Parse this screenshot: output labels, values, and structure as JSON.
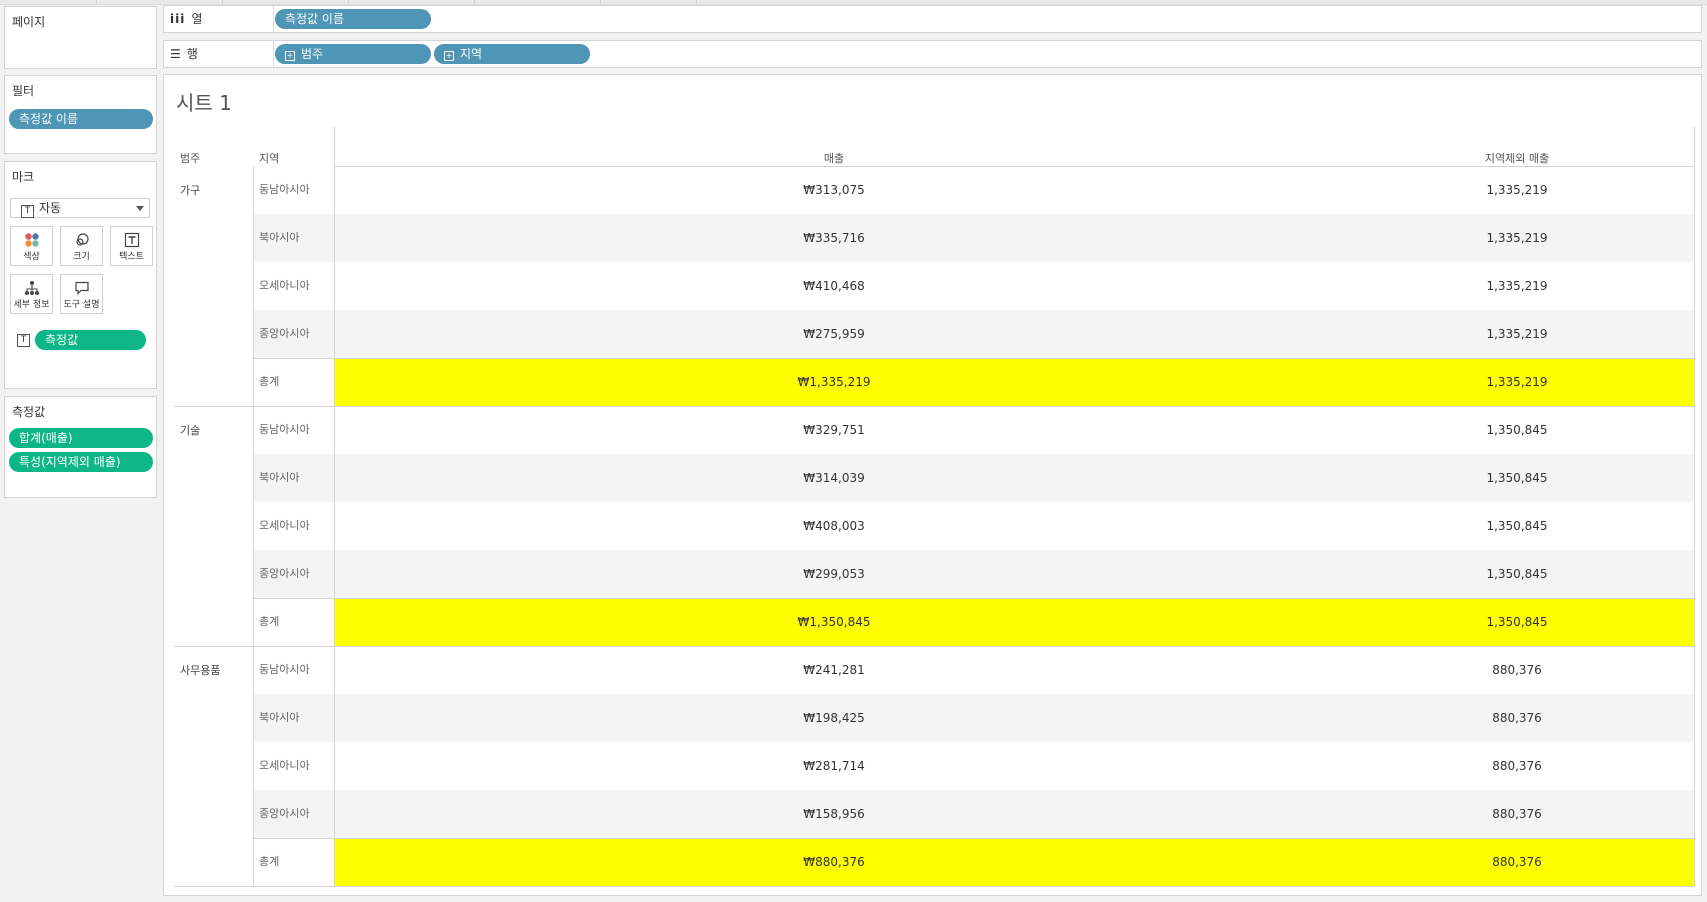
{
  "left_panel": {
    "pages_title": "페이지",
    "filters_title": "필터",
    "filter_pill": "측정값 이름",
    "marks_title": "마크",
    "mark_type": "자동",
    "mark_buttons": [
      {
        "label": "색상",
        "icon": "color-icon"
      },
      {
        "label": "크기",
        "icon": "size-icon"
      },
      {
        "label": "텍스트",
        "icon": "text-icon"
      },
      {
        "label": "세부 정보",
        "icon": "detail-icon"
      },
      {
        "label": "도구 설명",
        "icon": "tooltip-icon"
      }
    ],
    "mark_text_pill": "측정값",
    "measures_title": "측정값",
    "measure_pills": [
      "합계(매출)",
      "특성(지역제외 매출)"
    ]
  },
  "shelves": {
    "columns_label": "열",
    "columns_pill": "측정값 이름",
    "rows_label": "행",
    "rows_pills": [
      "범주",
      "지역"
    ]
  },
  "sheet": {
    "title": "시트 1",
    "headers": {
      "category": "범주",
      "region": "지역",
      "sales": "매출",
      "excl_sales": "지역제외 매출"
    },
    "groups": [
      {
        "category": "가구",
        "rows": [
          {
            "region": "동남아시아",
            "sales": "₩313,075",
            "excl": "1,335,219"
          },
          {
            "region": "북아시아",
            "sales": "₩335,716",
            "excl": "1,335,219"
          },
          {
            "region": "오세아니아",
            "sales": "₩410,468",
            "excl": "1,335,219"
          },
          {
            "region": "중앙아시아",
            "sales": "₩275,959",
            "excl": "1,335,219"
          },
          {
            "region": "총계",
            "sales": "₩1,335,219",
            "excl": "1,335,219",
            "total": true
          }
        ]
      },
      {
        "category": "기술",
        "rows": [
          {
            "region": "동남아시아",
            "sales": "₩329,751",
            "excl": "1,350,845"
          },
          {
            "region": "북아시아",
            "sales": "₩314,039",
            "excl": "1,350,845"
          },
          {
            "region": "오세아니아",
            "sales": "₩408,003",
            "excl": "1,350,845"
          },
          {
            "region": "중앙아시아",
            "sales": "₩299,053",
            "excl": "1,350,845"
          },
          {
            "region": "총계",
            "sales": "₩1,350,845",
            "excl": "1,350,845",
            "total": true
          }
        ]
      },
      {
        "category": "사무용품",
        "rows": [
          {
            "region": "동남아시아",
            "sales": "₩241,281",
            "excl": "880,376"
          },
          {
            "region": "북아시아",
            "sales": "₩198,425",
            "excl": "880,376"
          },
          {
            "region": "오세아니아",
            "sales": "₩281,714",
            "excl": "880,376"
          },
          {
            "region": "중앙아시아",
            "sales": "₩158,956",
            "excl": "880,376"
          },
          {
            "region": "총계",
            "sales": "₩880,376",
            "excl": "880,376",
            "total": true
          }
        ]
      }
    ]
  },
  "colors": {
    "pill_blue": "#4e95b6",
    "pill_green": "#0db686",
    "total_highlight": "#ffff00",
    "alt_row": "#f4f4f4"
  }
}
